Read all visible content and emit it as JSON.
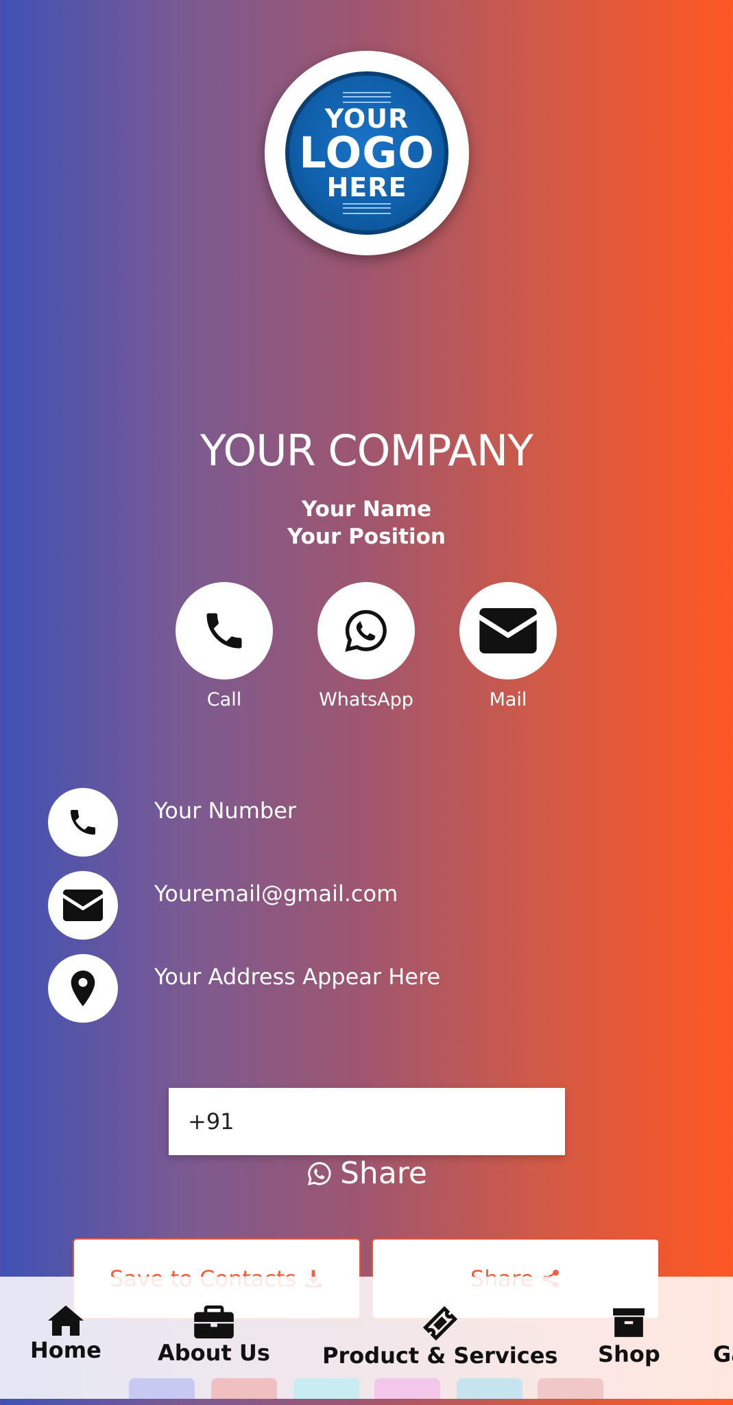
{
  "logo": {
    "line1": "YOUR",
    "line2": "LOGO",
    "line3": "HERE"
  },
  "company": "YOUR COMPANY",
  "person": {
    "name": "Your Name",
    "position": "Your Position"
  },
  "actions": [
    {
      "label": "Call",
      "icon": "phone-icon"
    },
    {
      "label": "WhatsApp",
      "icon": "whatsapp-icon"
    },
    {
      "label": "Mail",
      "icon": "envelope-icon"
    }
  ],
  "contact": {
    "number": "Your Number",
    "email": "Youremail@gmail.com",
    "address": "Your Address Appear Here"
  },
  "share_form": {
    "phone_value": "+91",
    "share_label": "Share"
  },
  "buttons": {
    "save_contacts": "Save to Contacts",
    "share": "Share"
  },
  "nav": [
    {
      "label": "Home",
      "icon": "home-icon"
    },
    {
      "label": "About Us",
      "icon": "briefcase-icon"
    },
    {
      "label": "Product & Services",
      "icon": "ticket-icon"
    },
    {
      "label": "Shop",
      "icon": "archive-box-icon"
    },
    {
      "label": "Ga",
      "icon": ""
    }
  ],
  "colors": {
    "gradient_left": "#3f51b5",
    "gradient_right": "#ff5722",
    "accent": "#f06040"
  }
}
